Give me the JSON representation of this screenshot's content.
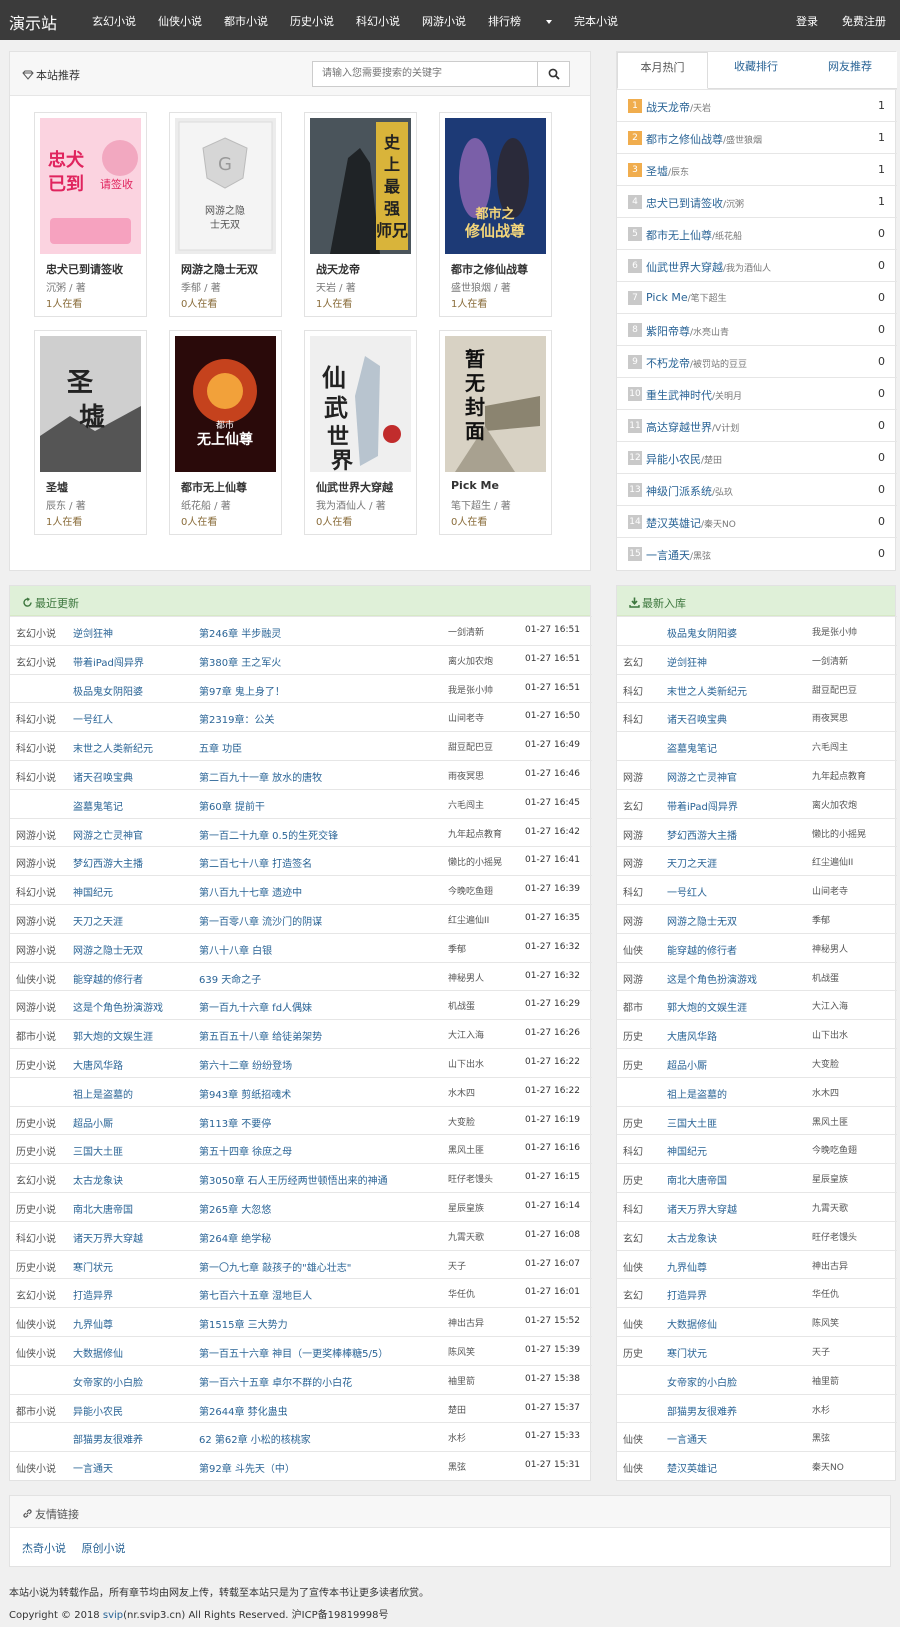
{
  "brand": "演示站",
  "nav": {
    "items": [
      "玄幻小说",
      "仙侠小说",
      "都市小说",
      "历史小说",
      "科幻小说",
      "网游小说",
      "排行榜",
      "完本小说"
    ],
    "login": "登录",
    "register": "免费注册"
  },
  "recommend": {
    "title": "本站推荐",
    "search_placeholder": "请输入您需要搜索的关键字",
    "books": [
      {
        "title": "忠犬已到请签收",
        "author": "沉粥 / 著",
        "readers": "1人在看"
      },
      {
        "title": "网游之隐士无双",
        "author": "季郁 / 著",
        "readers": "0人在看"
      },
      {
        "title": "战天龙帝",
        "author": "天岩 / 著",
        "readers": "1人在看"
      },
      {
        "title": "都市之修仙战尊",
        "author": "盛世狼烟 / 著",
        "readers": "1人在看"
      },
      {
        "title": "圣墟",
        "author": "辰东 / 著",
        "readers": "1人在看"
      },
      {
        "title": "都市无上仙尊",
        "author": "纸花船 / 著",
        "readers": "0人在看"
      },
      {
        "title": "仙武世界大穿越",
        "author": "我为酒仙人 / 著",
        "readers": "0人在看"
      },
      {
        "title": "Pick Me",
        "author": "笔下超生 / 著",
        "readers": "0人在看"
      }
    ],
    "cover_texts": [
      "天启 忠犬已到请签收",
      "网游之隐士无双",
      "史上最强师兄",
      "都市之修仙战尊",
      "圣墟",
      "都市 无上仙尊",
      "仙武世界",
      "暂无封面"
    ]
  },
  "hot": {
    "tabs": [
      "本月热门",
      "收藏排行",
      "网友推荐"
    ],
    "items": [
      {
        "rank": "1",
        "title": "战天龙帝",
        "author": "天岩",
        "count": "1"
      },
      {
        "rank": "2",
        "title": "都市之修仙战尊",
        "author": "盛世狼烟",
        "count": "1"
      },
      {
        "rank": "3",
        "title": "圣墟",
        "author": "辰东",
        "count": "1"
      },
      {
        "rank": "4",
        "title": "忠犬已到请签收",
        "author": "沉粥",
        "count": "1"
      },
      {
        "rank": "5",
        "title": "都市无上仙尊",
        "author": "纸花船",
        "count": "0"
      },
      {
        "rank": "6",
        "title": "仙武世界大穿越",
        "author": "我为酒仙人",
        "count": "0"
      },
      {
        "rank": "7",
        "title": "Pick Me",
        "author": "笔下超生",
        "count": "0"
      },
      {
        "rank": "8",
        "title": "紫阳帝尊",
        "author": "水亮山青",
        "count": "0"
      },
      {
        "rank": "9",
        "title": "不朽龙帝",
        "author": "被罚站的豆豆",
        "count": "0"
      },
      {
        "rank": "10",
        "title": "重生武神时代",
        "author": "关明月",
        "count": "0"
      },
      {
        "rank": "11",
        "title": "高达穿越世界",
        "author": "V计划",
        "count": "0"
      },
      {
        "rank": "12",
        "title": "异能小农民",
        "author": "楚田",
        "count": "0"
      },
      {
        "rank": "13",
        "title": "神级门派系统",
        "author": "弘玖",
        "count": "0"
      },
      {
        "rank": "14",
        "title": "楚汉英雄记",
        "author": "秦天NO",
        "count": "0"
      },
      {
        "rank": "15",
        "title": "一言通天",
        "author": "黑弦",
        "count": "0"
      }
    ]
  },
  "updates": {
    "title": "最近更新",
    "rows": [
      [
        "玄幻小说",
        "逆剑狂神",
        "第246章 半步融灵",
        "一剑清新",
        "01-27 16:51"
      ],
      [
        "玄幻小说",
        "带着iPad闯异界",
        "第380章 王之军火",
        "离火加农炮",
        "01-27 16:51"
      ],
      [
        "",
        "极品鬼女阴阳婆",
        "第97章 鬼上身了！",
        "我是张小帅",
        "01-27 16:51"
      ],
      [
        "科幻小说",
        "一号红人",
        "第2319章：公关",
        "山间老寺",
        "01-27 16:50"
      ],
      [
        "科幻小说",
        "末世之人类新纪元",
        "五章 功臣",
        "甜豆配巴豆",
        "01-27 16:49"
      ],
      [
        "科幻小说",
        "诸天召唤宝典",
        "第二百九十一章 放水的唐牧",
        "雨夜冥思",
        "01-27 16:46"
      ],
      [
        "",
        "盗墓鬼笔记",
        "第60章 提前干",
        "六毛闯主",
        "01-27 16:45"
      ],
      [
        "网游小说",
        "网游之亡灵神官",
        "第一百二十九章 0.5的生死交锋",
        "九年起点教育",
        "01-27 16:42"
      ],
      [
        "网游小说",
        "梦幻西游大主播",
        "第二百七十八章 打造签名",
        "懒比的小摇晃",
        "01-27 16:41"
      ],
      [
        "科幻小说",
        "神国纪元",
        "第八百九十七章 遗迹中",
        "今晚吃鱼翅",
        "01-27 16:39"
      ],
      [
        "网游小说",
        "天刀之天涯",
        "第一百零八章 流沙门的阴谋",
        "红尘遍仙II",
        "01-27 16:35"
      ],
      [
        "网游小说",
        "网游之隐士无双",
        "第八十八章 白银",
        "季郁",
        "01-27 16:32"
      ],
      [
        "仙侠小说",
        "能穿越的修行者",
        "639 天命之子",
        "神秘男人",
        "01-27 16:32"
      ],
      [
        "网游小说",
        "这是个角色扮演游戏",
        "第一百九十六章 fd人偶妹",
        "机战蛋",
        "01-27 16:29"
      ],
      [
        "都市小说",
        "郭大炮的文娱生涯",
        "第五百五十八章 给徒弟架势",
        "大江入海",
        "01-27 16:26"
      ],
      [
        "历史小说",
        "大唐风华路",
        "第六十二章 纷纷登场",
        "山下出水",
        "01-27 16:22"
      ],
      [
        "",
        "祖上是盗墓的",
        "第943章 剪纸招魂术",
        "水木四",
        "01-27 16:22"
      ],
      [
        "历史小说",
        "超品小厮",
        "第113章 不要停",
        "大变脸",
        "01-27 16:19"
      ],
      [
        "历史小说",
        "三国大土匪",
        "第五十四章 徐庶之母",
        "黑风土匪",
        "01-27 16:16"
      ],
      [
        "玄幻小说",
        "太古龙象诀",
        "第3050章 石人王历经两世顿悟出来的神通",
        "旺仔老馒头",
        "01-27 16:15"
      ],
      [
        "历史小说",
        "南北大唐帝国",
        "第265章 大忽悠",
        "星辰皇族",
        "01-27 16:14"
      ],
      [
        "科幻小说",
        "诸天万界大穿越",
        "第264章 绝学秘",
        "九霄天歌",
        "01-27 16:08"
      ],
      [
        "历史小说",
        "寒门状元",
        "第一〇九七章 敲孩子的\"雄心壮志\"",
        "天子",
        "01-27 16:07"
      ],
      [
        "玄幻小说",
        "打造异界",
        "第七百六十五章 湿地巨人",
        "华任仇",
        "01-27 16:01"
      ],
      [
        "仙侠小说",
        "九界仙尊",
        "第1515章 三大势力",
        "神出古异",
        "01-27 15:52"
      ],
      [
        "仙侠小说",
        "大数据修仙",
        "第一百五十六章 神目（一更奖棒棒糖5/5）",
        "陈风笑",
        "01-27 15:39"
      ],
      [
        "",
        "女帝家的小白脸",
        "第一百六十五章 卓尔不群的小白花",
        "袖里箭",
        "01-27 15:38"
      ],
      [
        "都市小说",
        "异能小农民",
        "第2644章 棼化蛊虫",
        "楚田",
        "01-27 15:37"
      ],
      [
        "",
        "部猫男友很难养",
        "62 第62章 小松的核桃家",
        "水杉",
        "01-27 15:33"
      ],
      [
        "仙侠小说",
        "一言通天",
        "第92章 斗先天（中）",
        "黑弦",
        "01-27 15:31"
      ]
    ]
  },
  "newbooks": {
    "title": "最新入库",
    "rows": [
      [
        "",
        "极品鬼女阴阳婆",
        "我是张小帅"
      ],
      [
        "玄幻",
        "逆剑狂神",
        "一剑清新"
      ],
      [
        "科幻",
        "末世之人类新纪元",
        "甜豆配巴豆"
      ],
      [
        "科幻",
        "诸天召唤宝典",
        "雨夜冥思"
      ],
      [
        "",
        "盗墓鬼笔记",
        "六毛闯主"
      ],
      [
        "网游",
        "网游之亡灵神官",
        "九年起点教育"
      ],
      [
        "玄幻",
        "带着iPad闯异界",
        "离火加农炮"
      ],
      [
        "网游",
        "梦幻西游大主播",
        "懒比的小摇晃"
      ],
      [
        "网游",
        "天刀之天涯",
        "红尘遍仙II"
      ],
      [
        "科幻",
        "一号红人",
        "山间老寺"
      ],
      [
        "网游",
        "网游之隐士无双",
        "季郁"
      ],
      [
        "仙侠",
        "能穿越的修行者",
        "神秘男人"
      ],
      [
        "网游",
        "这是个角色扮演游戏",
        "机战蛋"
      ],
      [
        "都市",
        "郭大炮的文娱生涯",
        "大江入海"
      ],
      [
        "历史",
        "大唐风华路",
        "山下出水"
      ],
      [
        "历史",
        "超品小厮",
        "大变脸"
      ],
      [
        "",
        "祖上是盗墓的",
        "水木四"
      ],
      [
        "历史",
        "三国大土匪",
        "黑风土匪"
      ],
      [
        "科幻",
        "神国纪元",
        "今晚吃鱼翅"
      ],
      [
        "历史",
        "南北大唐帝国",
        "星辰皇族"
      ],
      [
        "科幻",
        "诸天万界大穿越",
        "九霄天歌"
      ],
      [
        "玄幻",
        "太古龙象诀",
        "旺仔老馒头"
      ],
      [
        "仙侠",
        "九界仙尊",
        "神出古异"
      ],
      [
        "玄幻",
        "打造异界",
        "华任仇"
      ],
      [
        "仙侠",
        "大数据修仙",
        "陈风笑"
      ],
      [
        "历史",
        "寒门状元",
        "天子"
      ],
      [
        "",
        "女帝家的小白脸",
        "袖里箭"
      ],
      [
        "",
        "部猫男友很难养",
        "水杉"
      ],
      [
        "仙侠",
        "一言通天",
        "黑弦"
      ],
      [
        "仙侠",
        "楚汉英雄记",
        "秦天NO"
      ]
    ]
  },
  "links": {
    "title": "友情链接",
    "items": [
      "杰奇小说",
      "原创小说"
    ]
  },
  "footer": {
    "notice": "本站小说为转载作品，所有章节均由网友上传，转载至本站只是为了宣传本书让更多读者欣赏。",
    "copyright_pre": "Copyright © 2018 ",
    "copyright_link": "svip",
    "copyright_post": "(nr.svip3.cn) All Rights Reserved. 沪ICP备19819998号"
  }
}
